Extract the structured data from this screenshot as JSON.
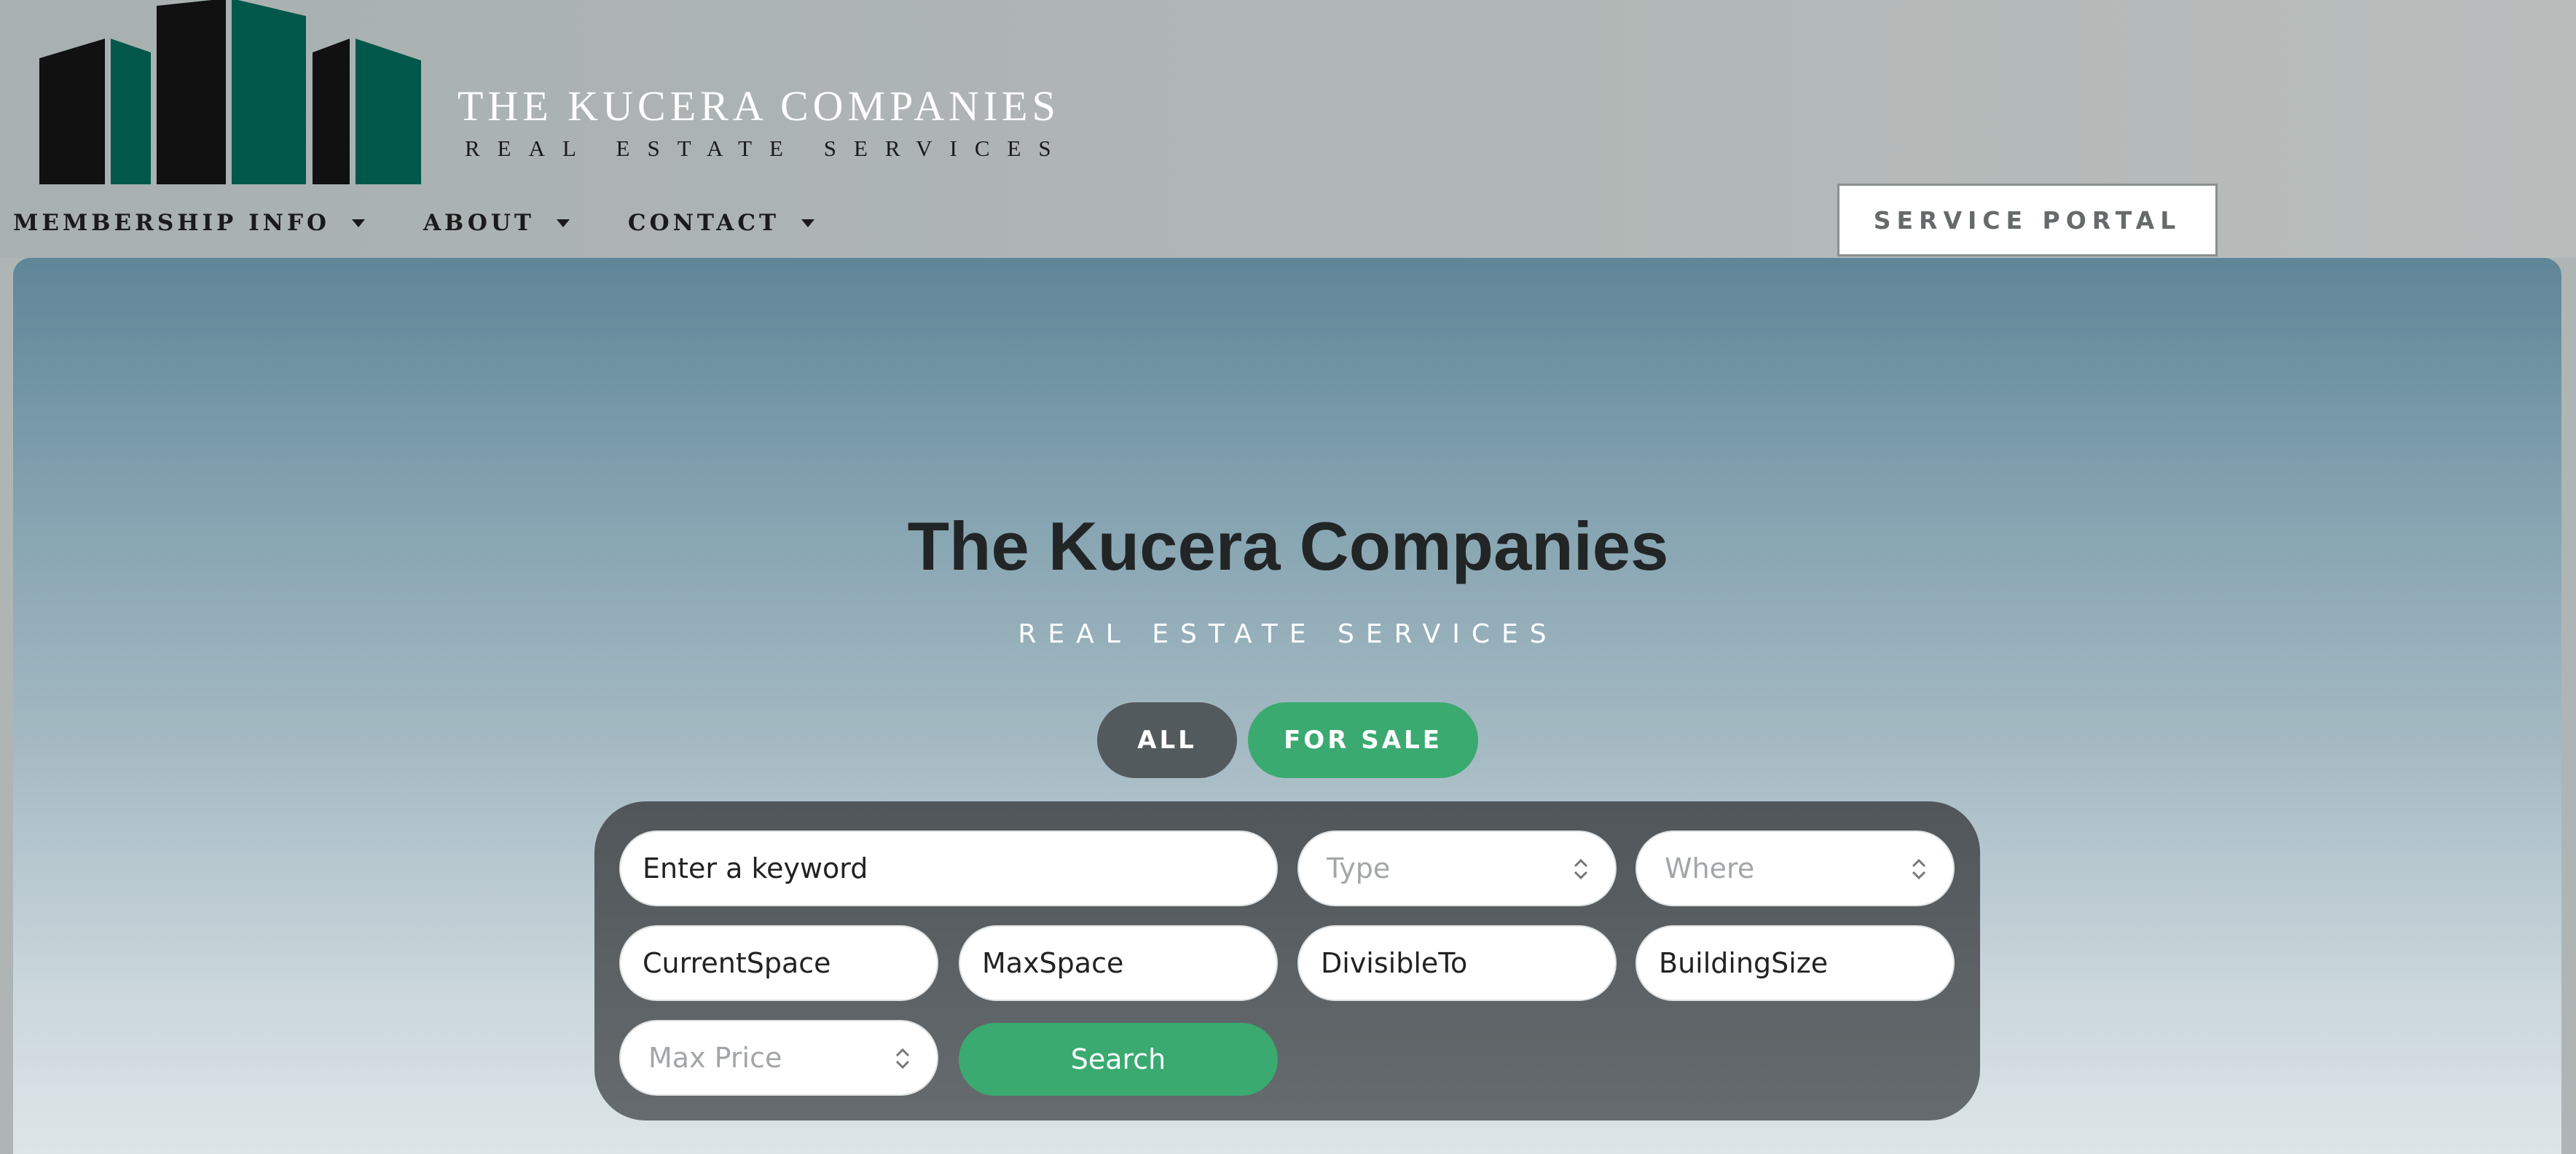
{
  "brand": {
    "name": "THE KUCERA COMPANIES",
    "tagline": "REAL ESTATE SERVICES",
    "colors": {
      "green": "#00574a",
      "black": "#111111"
    }
  },
  "nav": {
    "items": [
      {
        "label": "MEMBERSHIP INFO",
        "icon": "caret-down-icon"
      },
      {
        "label": "ABOUT",
        "icon": "caret-down-icon"
      },
      {
        "label": "CONTACT",
        "icon": "caret-down-icon"
      }
    ],
    "portal_label": "SERVICE PORTAL"
  },
  "hero": {
    "title": "The Kucera Companies",
    "subtitle": "REAL ESTATE SERVICES"
  },
  "tabs": [
    {
      "label": "ALL",
      "color": "#535a5e"
    },
    {
      "label": "FOR SALE",
      "color": "#3aaa70"
    }
  ],
  "search": {
    "keyword_placeholder": "Enter a keyword",
    "type_placeholder": "Type",
    "where_placeholder": "Where",
    "current_space_placeholder": "CurrentSpace",
    "max_space_placeholder": "MaxSpace",
    "divisible_to_placeholder": "DivisibleTo",
    "building_size_placeholder": "BuildingSize",
    "max_price_placeholder": "Max Price",
    "search_label": "Search",
    "accent": "#3aaa70"
  }
}
